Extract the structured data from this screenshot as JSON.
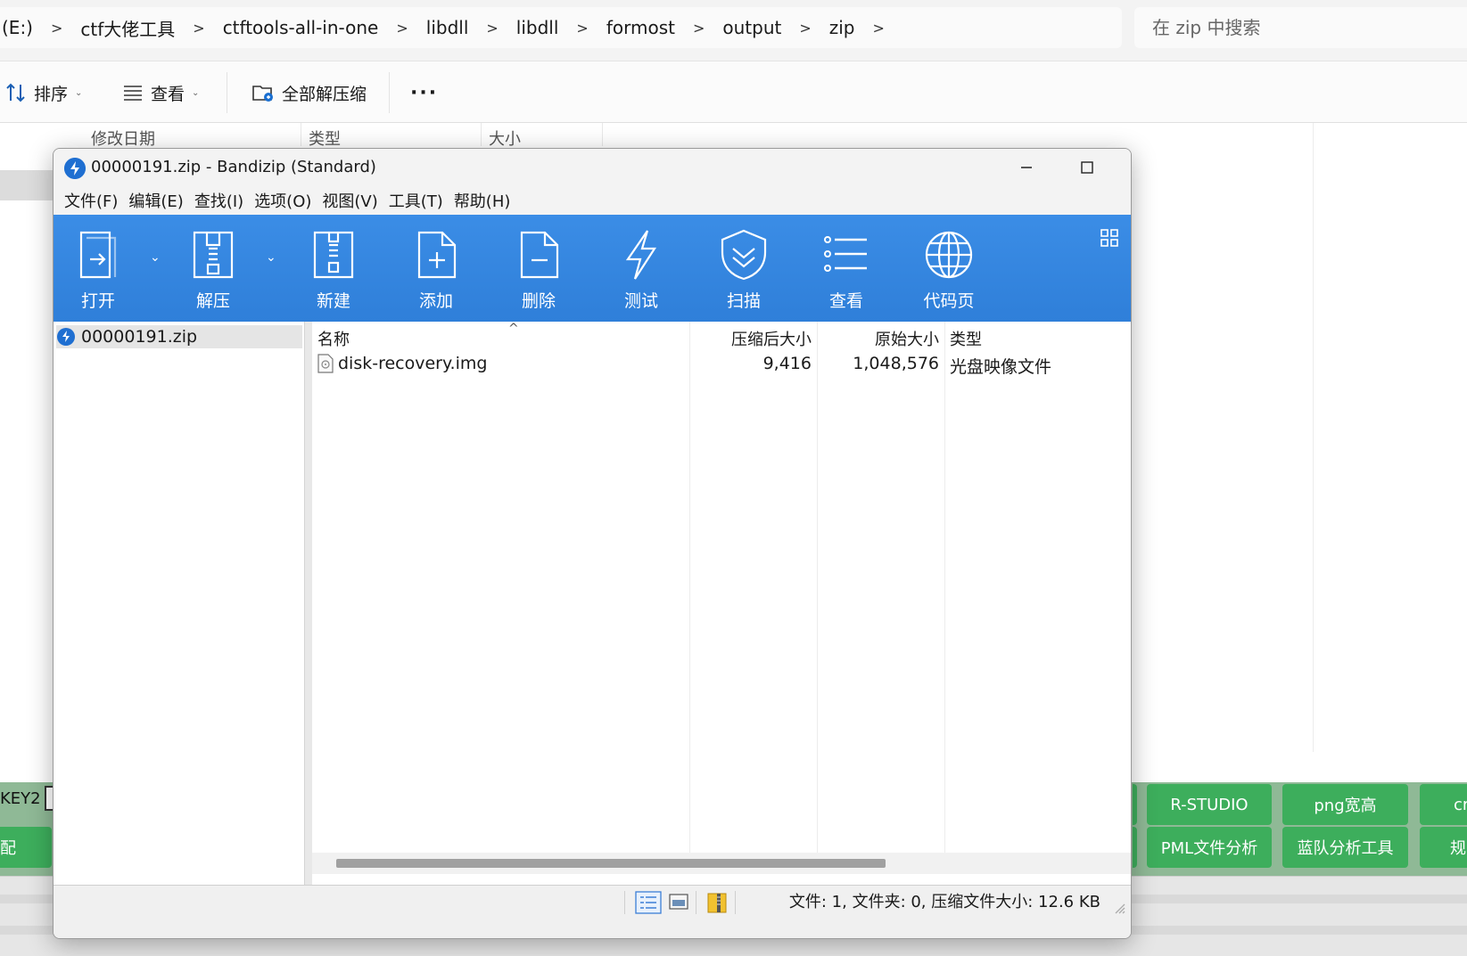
{
  "explorer": {
    "breadcrumbs": [
      "(E:)",
      "ctf大佬工具",
      "ctftools-all-in-one",
      "libdll",
      "libdll",
      "formost",
      "output",
      "zip"
    ],
    "search_placeholder": "在 zip 中搜索",
    "toolbar": {
      "sort_label": "排序",
      "view_label": "查看",
      "extract_all_label": "全部解压缩"
    },
    "columns": [
      "修改日期",
      "类型",
      "大小"
    ]
  },
  "launcher": {
    "key2_label": "KEY2",
    "buttons": [
      "R-STUDIO",
      "png宽高",
      "cr",
      "PML文件分析",
      "蓝队分析工具",
      "规",
      "配"
    ],
    "color": "#3dae5c"
  },
  "bandizip": {
    "title": "00000191.zip - Bandizip (Standard)",
    "menu": [
      "文件(F)",
      "编辑(E)",
      "查找(I)",
      "选项(O)",
      "视图(V)",
      "工具(T)",
      "帮助(H)"
    ],
    "toolbar": [
      {
        "label": "打开",
        "icon": "open-icon"
      },
      {
        "label": "解压",
        "icon": "extract-icon"
      },
      {
        "label": "新建",
        "icon": "new-archive-icon"
      },
      {
        "label": "添加",
        "icon": "add-file-icon"
      },
      {
        "label": "删除",
        "icon": "delete-file-icon"
      },
      {
        "label": "测试",
        "icon": "test-lightning-icon"
      },
      {
        "label": "扫描",
        "icon": "scan-shield-icon"
      },
      {
        "label": "查看",
        "icon": "view-list-icon"
      },
      {
        "label": "代码页",
        "icon": "codepage-globe-icon"
      }
    ],
    "toolbar_color": "#2f7fd9",
    "tree": {
      "root": "00000191.zip"
    },
    "columns": {
      "name": "名称",
      "packed": "压缩后大小",
      "original": "原始大小",
      "type": "类型"
    },
    "files": [
      {
        "name": "disk-recovery.img",
        "packed": "9,416",
        "original": "1,048,576",
        "type": "光盘映像文件"
      }
    ],
    "status": "文件: 1, 文件夹: 0, 压缩文件大小: 12.6 KB"
  }
}
